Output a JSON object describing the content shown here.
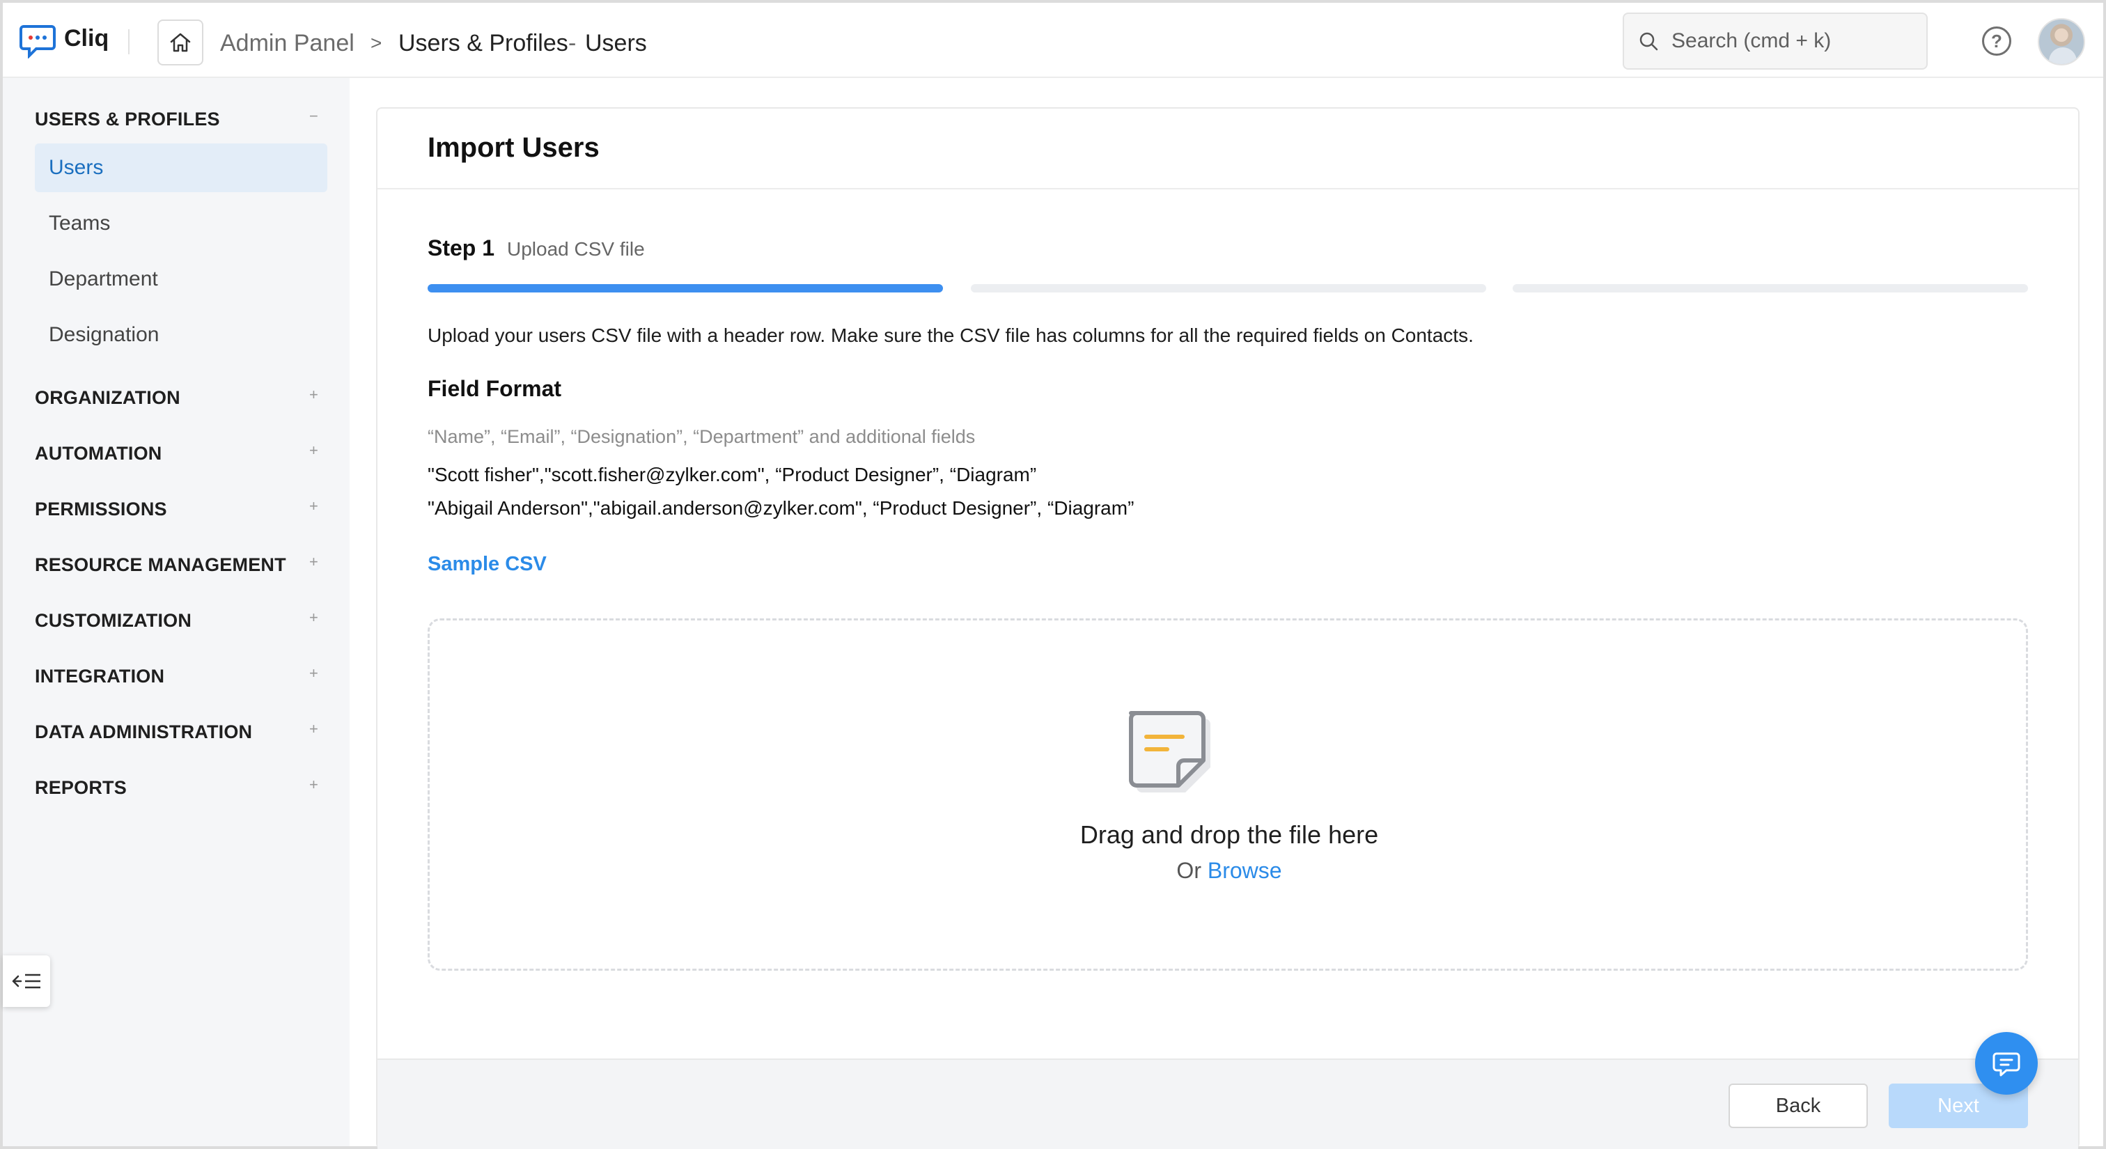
{
  "app": {
    "name": "Cliq"
  },
  "breadcrumb": {
    "root": "Admin Panel",
    "separator": ">",
    "section": "Users & Profiles",
    "dash": "-",
    "current": "Users"
  },
  "search": {
    "placeholder": "Search (cmd + k)"
  },
  "help": {
    "label": "?"
  },
  "sidebar": {
    "users_profiles": {
      "title": "USERS & PROFILES",
      "toggle": "−"
    },
    "items": [
      {
        "label": "Users",
        "active": true
      },
      {
        "label": "Teams"
      },
      {
        "label": "Department"
      },
      {
        "label": "Designation"
      }
    ],
    "sections": [
      {
        "title": "ORGANIZATION",
        "toggle": "+"
      },
      {
        "title": "AUTOMATION",
        "toggle": "+"
      },
      {
        "title": "PERMISSIONS",
        "toggle": "+"
      },
      {
        "title": "RESOURCE MANAGEMENT",
        "toggle": "+"
      },
      {
        "title": "CUSTOMIZATION",
        "toggle": "+"
      },
      {
        "title": "INTEGRATION",
        "toggle": "+"
      },
      {
        "title": "DATA ADMINISTRATION",
        "toggle": "+"
      },
      {
        "title": "REPORTS",
        "toggle": "+"
      }
    ]
  },
  "main": {
    "title": "Import Users",
    "step": {
      "label": "Step 1",
      "sub": "Upload CSV file",
      "current": 1,
      "total": 3
    },
    "description": "Upload your users CSV file with a header row. Make sure the CSV file has columns for all the required fields on Contacts.",
    "field_format": {
      "title": "Field Format",
      "hint": "“Name”, “Email”, “Designation”, “Department” and additional fields",
      "examples": [
        "\"Scott fisher\",\"scott.fisher@zylker.com\", “Product Designer”, “Diagram”",
        "\"Abigail Anderson\",\"abigail.anderson@zylker.com\", “Product Designer”, “Diagram”"
      ]
    },
    "sample_link": "Sample CSV",
    "dropzone": {
      "text": "Drag and drop the file here",
      "or": "Or",
      "browse": "Browse"
    },
    "buttons": {
      "back": "Back",
      "next": "Next"
    }
  },
  "colors": {
    "accent": "#3d8ff0",
    "link": "#2b8be8",
    "next_disabled": "#b8d9fb",
    "active_nav_bg": "#e3edf8"
  }
}
